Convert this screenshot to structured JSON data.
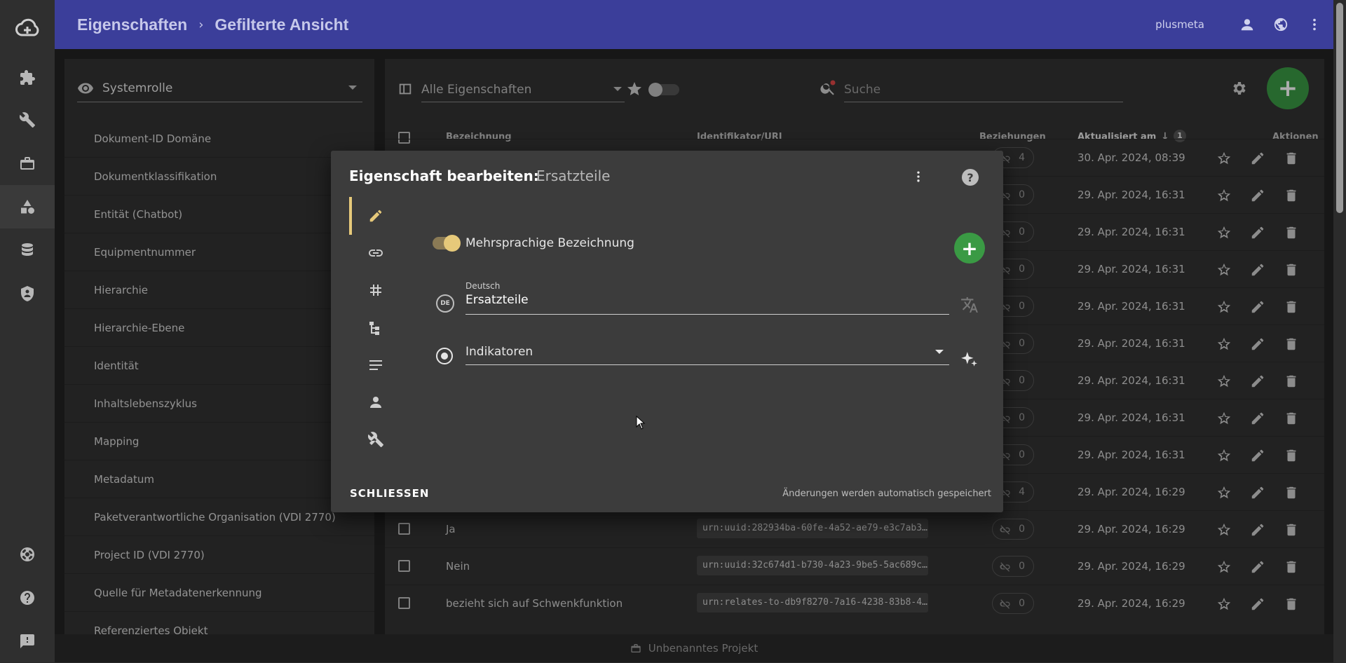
{
  "header": {
    "crumb1": "Eigenschaften",
    "crumb2": "Gefilterte Ansicht",
    "username": "plusmeta"
  },
  "sidebar_filter": {
    "role_select": "Systemrolle",
    "items": [
      "Dokument-ID Domäne",
      "Dokumentklassifikation",
      "Entität (Chatbot)",
      "Equipmentnummer",
      "Hierarchie",
      "Hierarchie-Ebene",
      "Identität",
      "Inhaltslebenszyklus",
      "Mapping",
      "Metadatum",
      "Paketverantwortliche Organisation (VDI 2770)",
      "Project ID (VDI 2770)",
      "Quelle für Metadatenerkennung",
      "Referenziertes Objekt"
    ]
  },
  "toolbar": {
    "filter_select": "Alle Eigenschaften",
    "search_placeholder": "Suche"
  },
  "table": {
    "headers": {
      "name": "Bezeichnung",
      "uri": "Identifikator/URI",
      "relations": "Beziehungen",
      "updated": "Aktualisiert am",
      "sort_badge": "1",
      "actions": "Aktionen"
    },
    "rows": [
      {
        "name": "",
        "uri": "",
        "rel": "4",
        "date": "30. Apr. 2024, 08:39"
      },
      {
        "name": "",
        "uri": "",
        "rel": "0",
        "date": "29. Apr. 2024, 16:31"
      },
      {
        "name": "",
        "uri": "",
        "rel": "0",
        "date": "29. Apr. 2024, 16:31"
      },
      {
        "name": "",
        "uri": "",
        "rel": "0",
        "date": "29. Apr. 2024, 16:31"
      },
      {
        "name": "",
        "uri": "",
        "rel": "0",
        "date": "29. Apr. 2024, 16:31"
      },
      {
        "name": "",
        "uri": "",
        "rel": "0",
        "date": "29. Apr. 2024, 16:31"
      },
      {
        "name": "",
        "uri": "",
        "rel": "0",
        "date": "29. Apr. 2024, 16:31"
      },
      {
        "name": "",
        "uri": "",
        "rel": "0",
        "date": "29. Apr. 2024, 16:31"
      },
      {
        "name": "",
        "uri": "",
        "rel": "0",
        "date": "29. Apr. 2024, 16:31"
      },
      {
        "name": "",
        "uri": "",
        "rel": "4",
        "date": "29. Apr. 2024, 16:29"
      },
      {
        "name": "Ja",
        "uri": "urn:uuid:282934ba-60fe-4a52-ae79-e3c7ab3…",
        "rel": "0",
        "date": "29. Apr. 2024, 16:29"
      },
      {
        "name": "Nein",
        "uri": "urn:uuid:32c674d1-b730-4a23-9be5-5ac689c…",
        "rel": "0",
        "date": "29. Apr. 2024, 16:29"
      },
      {
        "name": "bezieht sich auf Schwenkfunktion",
        "uri": "urn:relates-to-db9f8270-7a16-4238-83b8-4…",
        "rel": "0",
        "date": "29. Apr. 2024, 16:29"
      }
    ]
  },
  "footer": {
    "project": "Unbenanntes Projekt"
  },
  "dialog": {
    "title": "Eigenschaft bearbeiten:",
    "subtitle": "Ersatzteile",
    "toggle_label": "Mehrsprachige Bezeichnung",
    "lang_badge": "DE",
    "lang_label": "Deutsch",
    "lang_value": "Ersatzteile",
    "type_select": "Indikatoren",
    "close_button": "SCHLIESSEN",
    "autosave_note": "Änderungen werden automatisch gespeichert"
  }
}
